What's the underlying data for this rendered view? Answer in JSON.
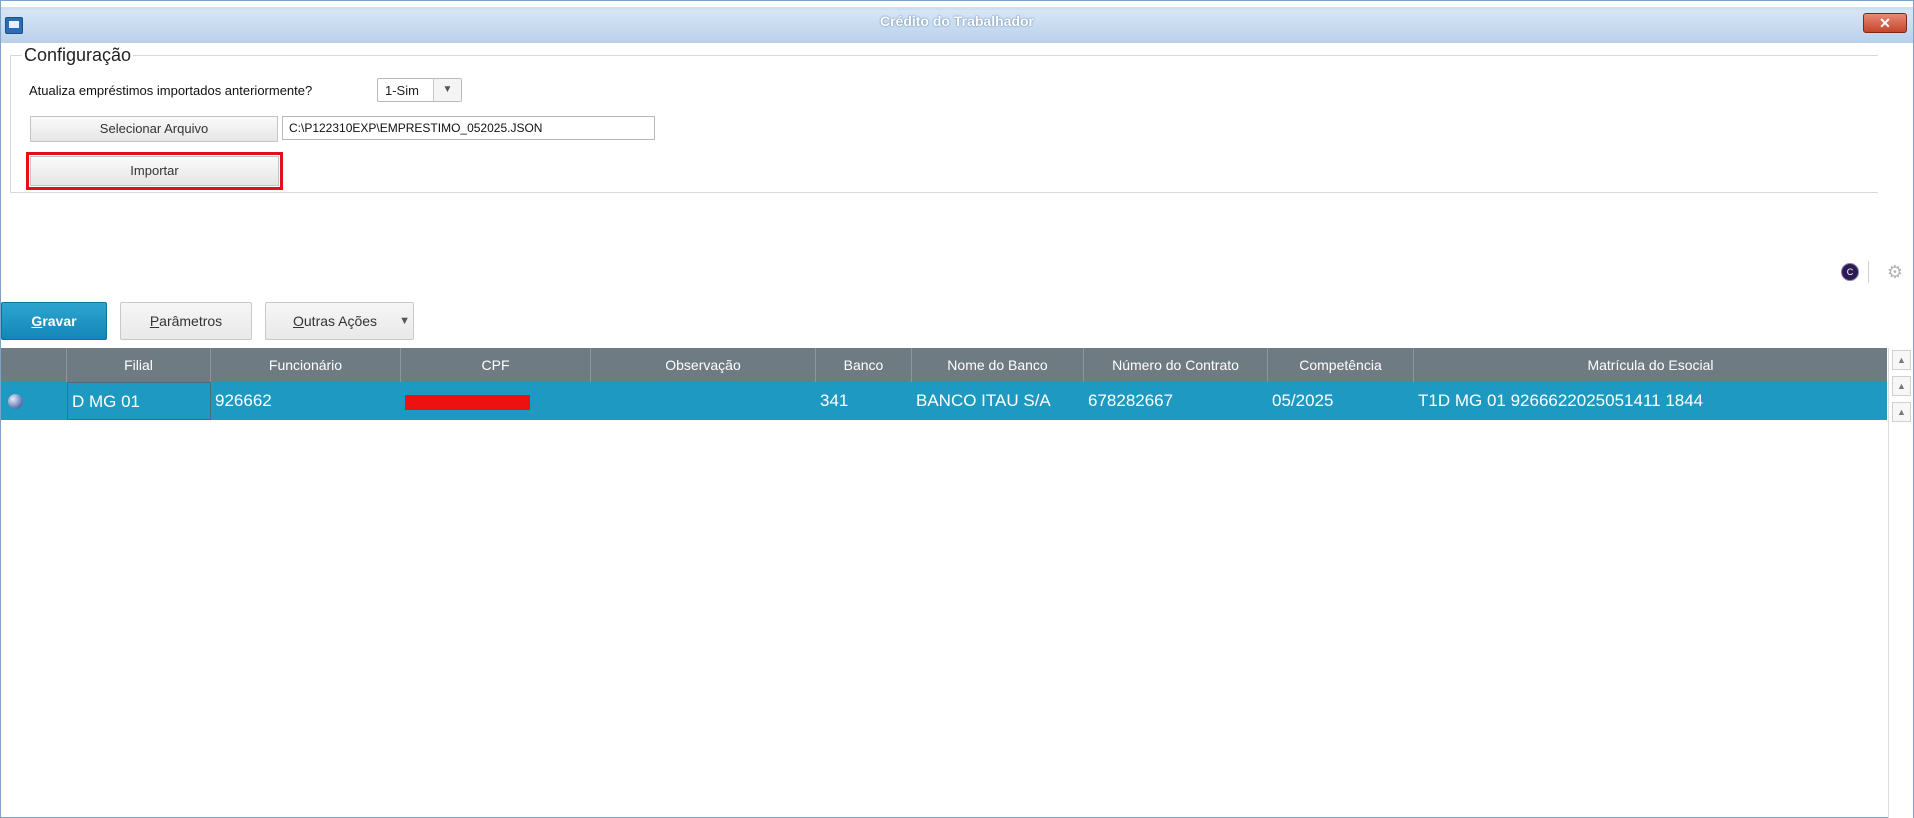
{
  "window": {
    "title": "Crédito do Trabalhador",
    "close_label": "✕"
  },
  "config": {
    "legend": "Configuração",
    "update_label": "Atualiza empréstimos importados anteriormente?",
    "update_value": "1-Sim",
    "select_file_label": "Selecionar Arquivo",
    "file_path": "C:\\P122310EXP\\EMPRESTIMO_052025.JSON",
    "import_label": "Importar"
  },
  "toolbar": {
    "circle_icon_glyph": "C",
    "gear_icon_glyph": "⚙"
  },
  "actions": {
    "save": {
      "u": "G",
      "rest": "ravar"
    },
    "params": {
      "u": "P",
      "rest": "arâmetros"
    },
    "other": {
      "u": "O",
      "rest": "utras Ações"
    },
    "other_arrow": "▼"
  },
  "grid": {
    "columns": [
      "",
      "Filial",
      "Funcionário",
      "CPF",
      "Observação",
      "Banco",
      "Nome do Banco",
      "Número do Contrato",
      "Competência",
      "Matrícula do Esocial"
    ],
    "rows": [
      {
        "filial": "D MG 01",
        "funcionario": "926662",
        "cpf": "",
        "observacao": "",
        "banco": "341",
        "nome_banco": "BANCO ITAU S/A",
        "contrato": "678282667",
        "competencia": "05/2025",
        "matricula": "T1D MG 01 9266622025051411 1844"
      }
    ]
  },
  "colors": {
    "accent": "#1e9ac2",
    "header": "#6f7b82",
    "highlight": "#e3101a"
  }
}
